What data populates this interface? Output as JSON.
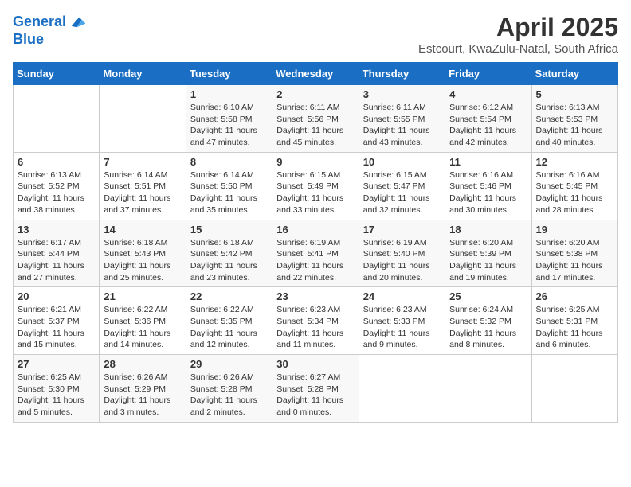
{
  "header": {
    "logo_line1": "General",
    "logo_line2": "Blue",
    "title": "April 2025",
    "subtitle": "Estcourt, KwaZulu-Natal, South Africa"
  },
  "days_of_week": [
    "Sunday",
    "Monday",
    "Tuesday",
    "Wednesday",
    "Thursday",
    "Friday",
    "Saturday"
  ],
  "weeks": [
    [
      {
        "day": "",
        "sunrise": "",
        "sunset": "",
        "daylight": ""
      },
      {
        "day": "",
        "sunrise": "",
        "sunset": "",
        "daylight": ""
      },
      {
        "day": "1",
        "sunrise": "Sunrise: 6:10 AM",
        "sunset": "Sunset: 5:58 PM",
        "daylight": "Daylight: 11 hours and 47 minutes."
      },
      {
        "day": "2",
        "sunrise": "Sunrise: 6:11 AM",
        "sunset": "Sunset: 5:56 PM",
        "daylight": "Daylight: 11 hours and 45 minutes."
      },
      {
        "day": "3",
        "sunrise": "Sunrise: 6:11 AM",
        "sunset": "Sunset: 5:55 PM",
        "daylight": "Daylight: 11 hours and 43 minutes."
      },
      {
        "day": "4",
        "sunrise": "Sunrise: 6:12 AM",
        "sunset": "Sunset: 5:54 PM",
        "daylight": "Daylight: 11 hours and 42 minutes."
      },
      {
        "day": "5",
        "sunrise": "Sunrise: 6:13 AM",
        "sunset": "Sunset: 5:53 PM",
        "daylight": "Daylight: 11 hours and 40 minutes."
      }
    ],
    [
      {
        "day": "6",
        "sunrise": "Sunrise: 6:13 AM",
        "sunset": "Sunset: 5:52 PM",
        "daylight": "Daylight: 11 hours and 38 minutes."
      },
      {
        "day": "7",
        "sunrise": "Sunrise: 6:14 AM",
        "sunset": "Sunset: 5:51 PM",
        "daylight": "Daylight: 11 hours and 37 minutes."
      },
      {
        "day": "8",
        "sunrise": "Sunrise: 6:14 AM",
        "sunset": "Sunset: 5:50 PM",
        "daylight": "Daylight: 11 hours and 35 minutes."
      },
      {
        "day": "9",
        "sunrise": "Sunrise: 6:15 AM",
        "sunset": "Sunset: 5:49 PM",
        "daylight": "Daylight: 11 hours and 33 minutes."
      },
      {
        "day": "10",
        "sunrise": "Sunrise: 6:15 AM",
        "sunset": "Sunset: 5:47 PM",
        "daylight": "Daylight: 11 hours and 32 minutes."
      },
      {
        "day": "11",
        "sunrise": "Sunrise: 6:16 AM",
        "sunset": "Sunset: 5:46 PM",
        "daylight": "Daylight: 11 hours and 30 minutes."
      },
      {
        "day": "12",
        "sunrise": "Sunrise: 6:16 AM",
        "sunset": "Sunset: 5:45 PM",
        "daylight": "Daylight: 11 hours and 28 minutes."
      }
    ],
    [
      {
        "day": "13",
        "sunrise": "Sunrise: 6:17 AM",
        "sunset": "Sunset: 5:44 PM",
        "daylight": "Daylight: 11 hours and 27 minutes."
      },
      {
        "day": "14",
        "sunrise": "Sunrise: 6:18 AM",
        "sunset": "Sunset: 5:43 PM",
        "daylight": "Daylight: 11 hours and 25 minutes."
      },
      {
        "day": "15",
        "sunrise": "Sunrise: 6:18 AM",
        "sunset": "Sunset: 5:42 PM",
        "daylight": "Daylight: 11 hours and 23 minutes."
      },
      {
        "day": "16",
        "sunrise": "Sunrise: 6:19 AM",
        "sunset": "Sunset: 5:41 PM",
        "daylight": "Daylight: 11 hours and 22 minutes."
      },
      {
        "day": "17",
        "sunrise": "Sunrise: 6:19 AM",
        "sunset": "Sunset: 5:40 PM",
        "daylight": "Daylight: 11 hours and 20 minutes."
      },
      {
        "day": "18",
        "sunrise": "Sunrise: 6:20 AM",
        "sunset": "Sunset: 5:39 PM",
        "daylight": "Daylight: 11 hours and 19 minutes."
      },
      {
        "day": "19",
        "sunrise": "Sunrise: 6:20 AM",
        "sunset": "Sunset: 5:38 PM",
        "daylight": "Daylight: 11 hours and 17 minutes."
      }
    ],
    [
      {
        "day": "20",
        "sunrise": "Sunrise: 6:21 AM",
        "sunset": "Sunset: 5:37 PM",
        "daylight": "Daylight: 11 hours and 15 minutes."
      },
      {
        "day": "21",
        "sunrise": "Sunrise: 6:22 AM",
        "sunset": "Sunset: 5:36 PM",
        "daylight": "Daylight: 11 hours and 14 minutes."
      },
      {
        "day": "22",
        "sunrise": "Sunrise: 6:22 AM",
        "sunset": "Sunset: 5:35 PM",
        "daylight": "Daylight: 11 hours and 12 minutes."
      },
      {
        "day": "23",
        "sunrise": "Sunrise: 6:23 AM",
        "sunset": "Sunset: 5:34 PM",
        "daylight": "Daylight: 11 hours and 11 minutes."
      },
      {
        "day": "24",
        "sunrise": "Sunrise: 6:23 AM",
        "sunset": "Sunset: 5:33 PM",
        "daylight": "Daylight: 11 hours and 9 minutes."
      },
      {
        "day": "25",
        "sunrise": "Sunrise: 6:24 AM",
        "sunset": "Sunset: 5:32 PM",
        "daylight": "Daylight: 11 hours and 8 minutes."
      },
      {
        "day": "26",
        "sunrise": "Sunrise: 6:25 AM",
        "sunset": "Sunset: 5:31 PM",
        "daylight": "Daylight: 11 hours and 6 minutes."
      }
    ],
    [
      {
        "day": "27",
        "sunrise": "Sunrise: 6:25 AM",
        "sunset": "Sunset: 5:30 PM",
        "daylight": "Daylight: 11 hours and 5 minutes."
      },
      {
        "day": "28",
        "sunrise": "Sunrise: 6:26 AM",
        "sunset": "Sunset: 5:29 PM",
        "daylight": "Daylight: 11 hours and 3 minutes."
      },
      {
        "day": "29",
        "sunrise": "Sunrise: 6:26 AM",
        "sunset": "Sunset: 5:28 PM",
        "daylight": "Daylight: 11 hours and 2 minutes."
      },
      {
        "day": "30",
        "sunrise": "Sunrise: 6:27 AM",
        "sunset": "Sunset: 5:28 PM",
        "daylight": "Daylight: 11 hours and 0 minutes."
      },
      {
        "day": "",
        "sunrise": "",
        "sunset": "",
        "daylight": ""
      },
      {
        "day": "",
        "sunrise": "",
        "sunset": "",
        "daylight": ""
      },
      {
        "day": "",
        "sunrise": "",
        "sunset": "",
        "daylight": ""
      }
    ]
  ]
}
